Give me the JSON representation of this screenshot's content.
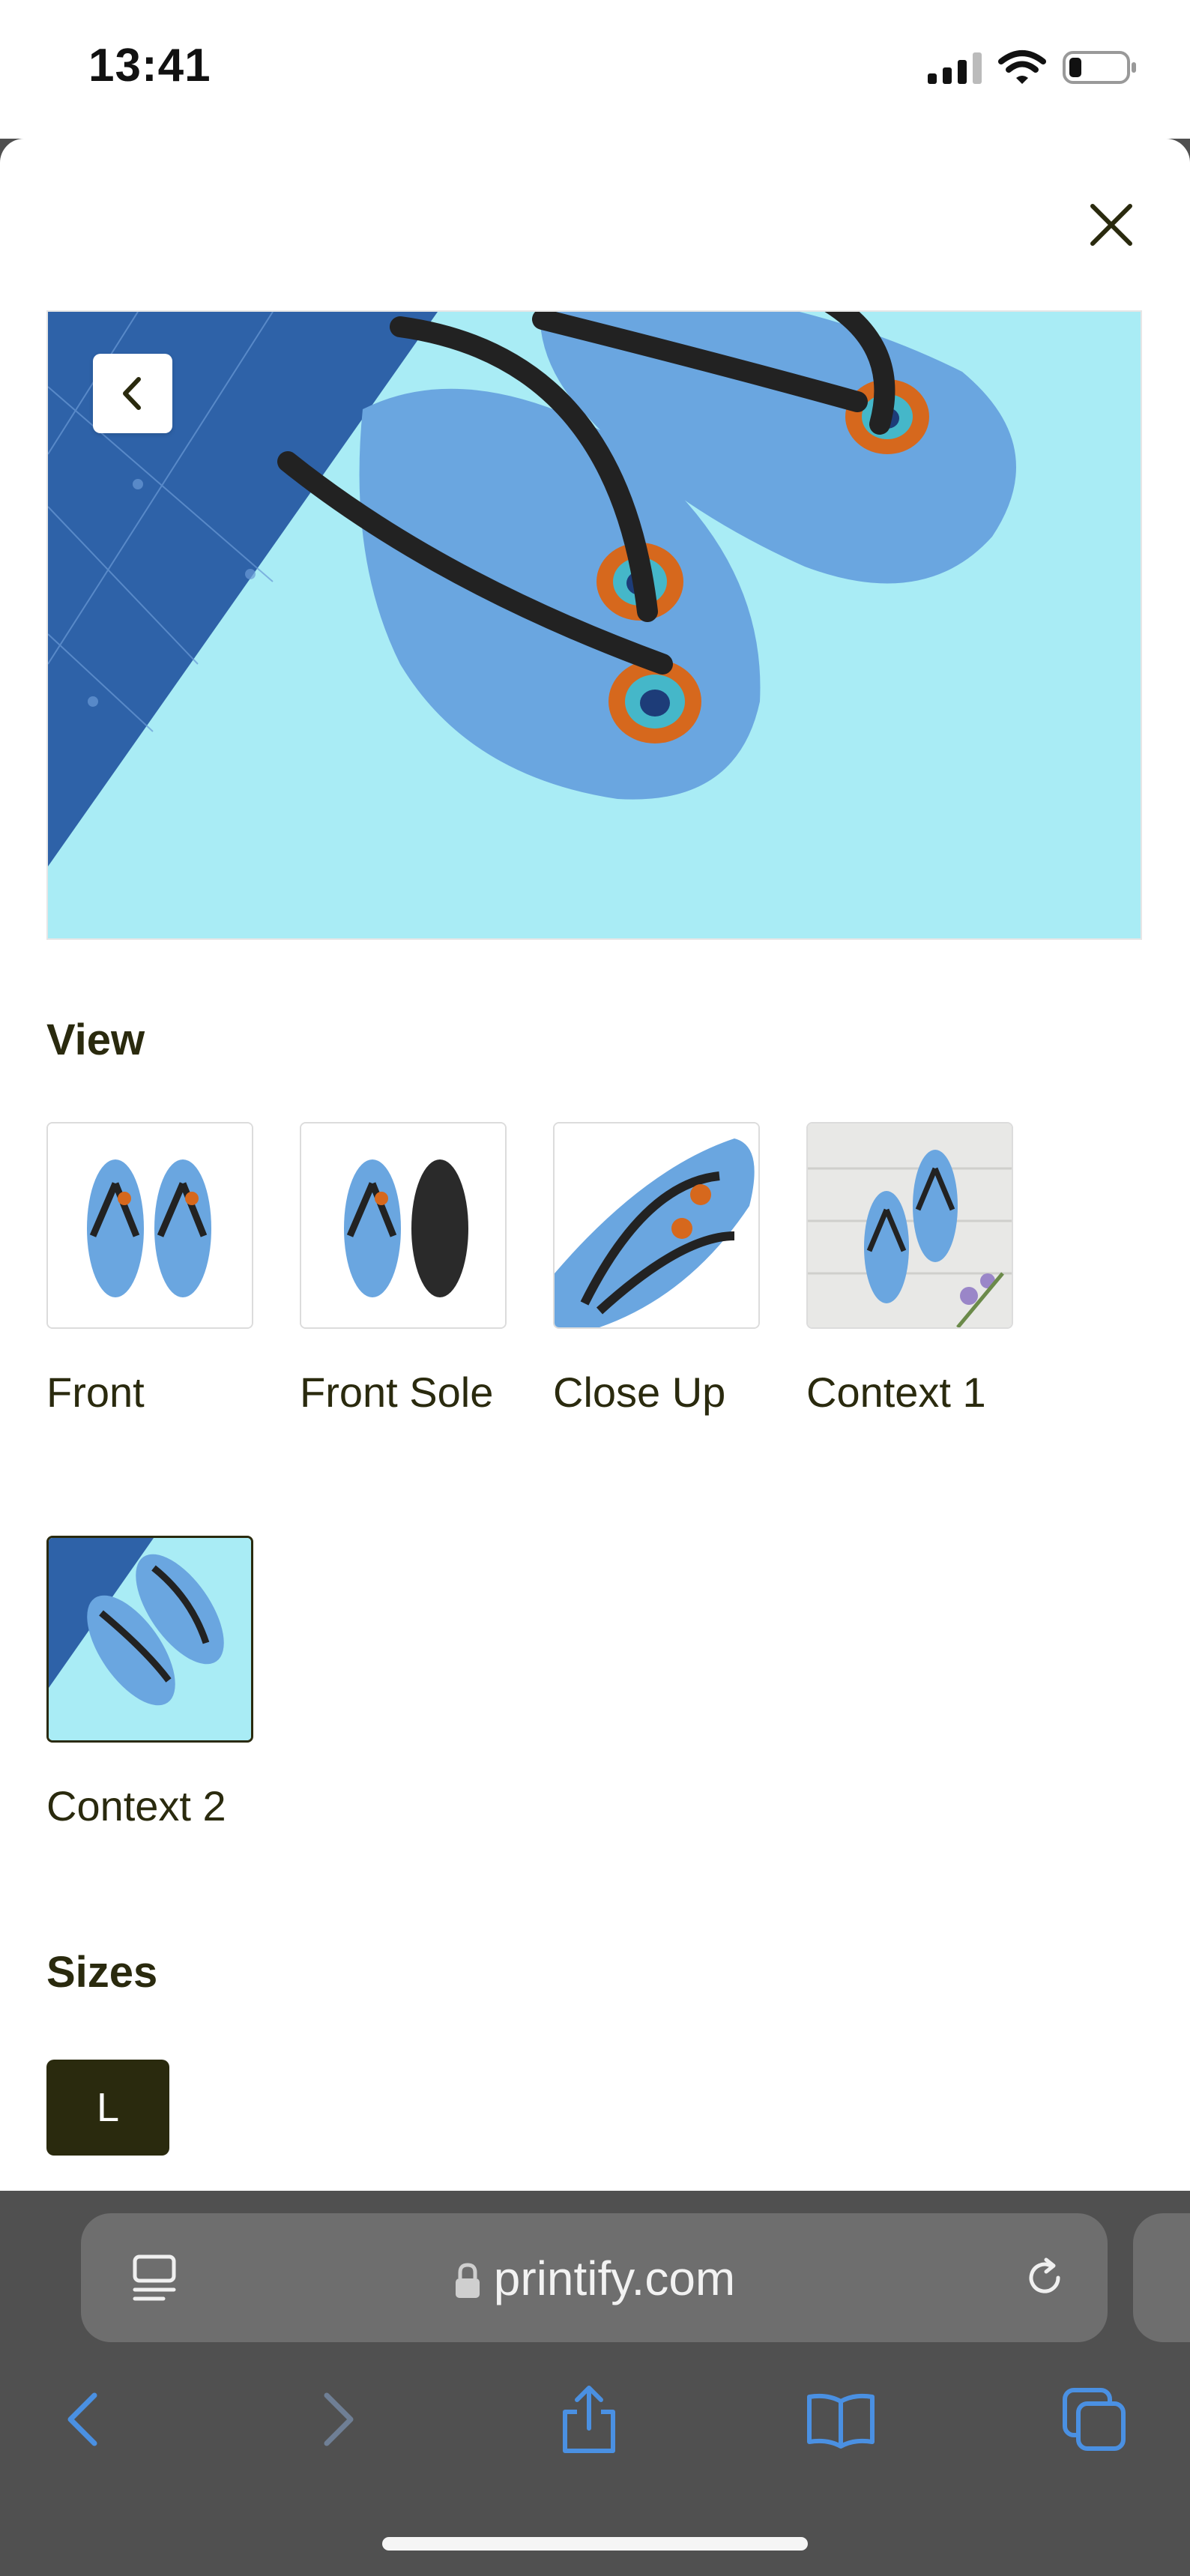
{
  "status_bar": {
    "time": "13:41"
  },
  "modal": {
    "close_icon": "close-icon",
    "hero_back_icon": "chevron-left-icon",
    "view_title": "View",
    "views": [
      {
        "label": "Front",
        "selected": false
      },
      {
        "label": "Front Sole",
        "selected": false
      },
      {
        "label": "Close Up",
        "selected": false
      },
      {
        "label": "Context 1",
        "selected": false
      },
      {
        "label": "Context 2",
        "selected": true
      }
    ],
    "sizes_title": "Sizes",
    "sizes": [
      {
        "label": "L",
        "selected": true
      }
    ]
  },
  "browser": {
    "url": "printify.com",
    "accent_color": "#4a90e2",
    "toolbar": [
      "back-icon",
      "forward-icon",
      "share-icon",
      "bookmarks-icon",
      "tabs-icon"
    ]
  }
}
